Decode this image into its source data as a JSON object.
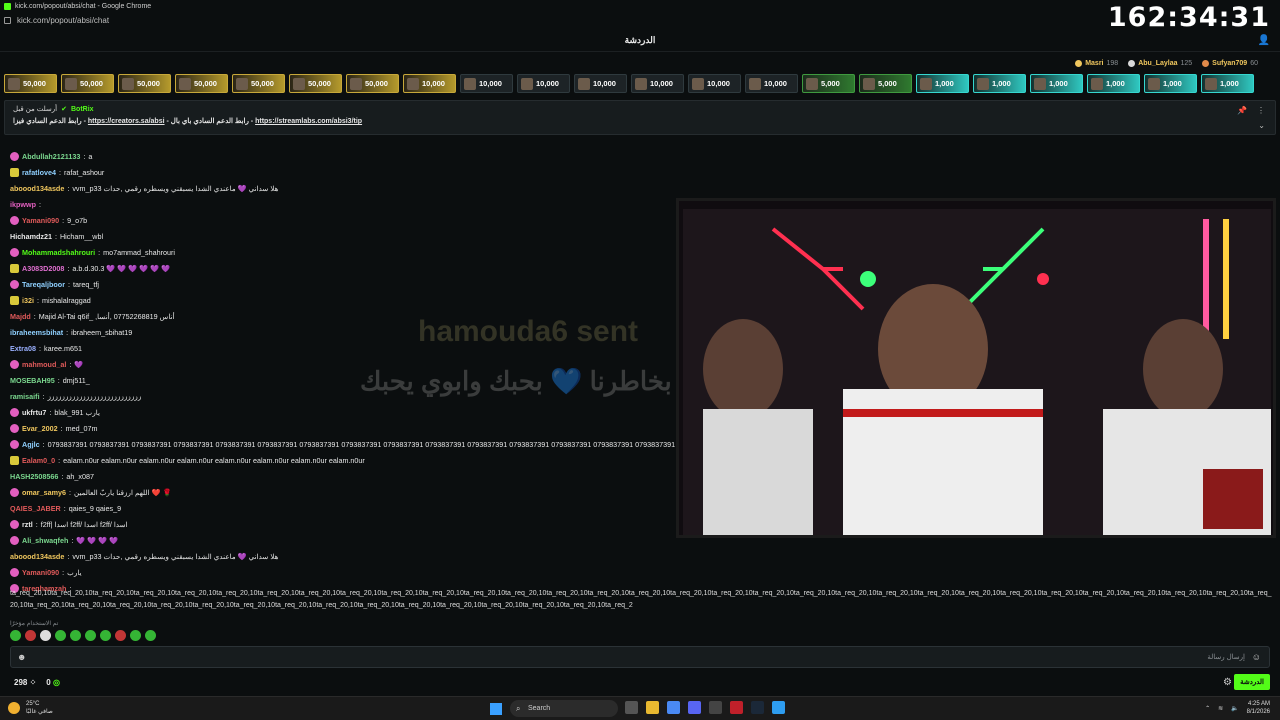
{
  "window": {
    "title": "kick.com/popout/absi/chat - Google Chrome",
    "url": "kick.com/popout/absi/chat"
  },
  "clock": "162:34:31",
  "header": {
    "title": "الدردشة"
  },
  "leaderboard": [
    {
      "name": "Masri",
      "count": "198",
      "color": "#f0c75e"
    },
    {
      "name": "Abu_Laylaa",
      "count": "125",
      "color": "#d9d9d9"
    },
    {
      "name": "Sufyan709",
      "count": "60",
      "color": "#e08a4a"
    }
  ],
  "gifts": [
    {
      "amount": "50,000",
      "style": "gold"
    },
    {
      "amount": "50,000",
      "style": "gold"
    },
    {
      "amount": "50,000",
      "style": "gold"
    },
    {
      "amount": "50,000",
      "style": "gold"
    },
    {
      "amount": "50,000",
      "style": "gold"
    },
    {
      "amount": "50,000",
      "style": "gold"
    },
    {
      "amount": "50,000",
      "style": "gold"
    },
    {
      "amount": "10,000",
      "style": "gold"
    },
    {
      "amount": "10,000",
      "style": "dark"
    },
    {
      "amount": "10,000",
      "style": "dark"
    },
    {
      "amount": "10,000",
      "style": "dark"
    },
    {
      "amount": "10,000",
      "style": "dark"
    },
    {
      "amount": "10,000",
      "style": "dark"
    },
    {
      "amount": "10,000",
      "style": "dark"
    },
    {
      "amount": "5,000",
      "style": "green"
    },
    {
      "amount": "5,000",
      "style": "green"
    },
    {
      "amount": "1,000",
      "style": "teal"
    },
    {
      "amount": "1,000",
      "style": "teal"
    },
    {
      "amount": "1,000",
      "style": "teal"
    },
    {
      "amount": "1,000",
      "style": "teal"
    },
    {
      "amount": "1,000",
      "style": "teal"
    },
    {
      "amount": "1,000",
      "style": "teal"
    }
  ],
  "pinned": {
    "pinned_by": "أرسلت من قبل",
    "bot_name": "BotRix",
    "text_before": "رابط الدعم السادي فيزا - ",
    "link1": "https://creators.sa/absi",
    "text_mid": " - رابط الدعم السادي باي بال - ",
    "link2": "https://streamlabs.com/absi3/tip"
  },
  "messages": [
    {
      "user": "Abdullah2121133",
      "text": "a",
      "color": "#7bd88f",
      "badge": "pink"
    },
    {
      "user": "rafatlove4",
      "text": "rafat_ashour",
      "color": "#8fd0ff",
      "badge": "yellow"
    },
    {
      "user": "aboood134asde",
      "text": "vvm_p33 هلا سداني 💜 ماعندي الشدا يسبقني ويسطره رقمي ,حدات",
      "color": "#f0c75e",
      "badge": ""
    },
    {
      "user": "ikpwwp",
      "text": "",
      "color": "#e25fbf",
      "badge": ""
    },
    {
      "user": "Yamani090",
      "text": "9_o7b",
      "color": "#e05a5a",
      "badge": "pink"
    },
    {
      "user": "Hichamdz21",
      "text": "Hicham__wbl",
      "color": "#e8e8e8",
      "badge": ""
    },
    {
      "user": "Mohammadshahrouri",
      "text": "mo7ammad_shahrouri",
      "color": "#53fc18",
      "badge": "pink"
    },
    {
      "user": "A3083D2008",
      "text": "a.b.d.30.3 💜 💜 💜 💜 💜 💜",
      "color": "#e06fd0",
      "badge": "yellow"
    },
    {
      "user": "Tareqaljboor",
      "text": "tareq_tfj",
      "color": "#8fd0ff",
      "badge": "pink"
    },
    {
      "user": "i32i",
      "text": "mishalalraggad",
      "color": "#f0c75e",
      "badge": "yellow"
    },
    {
      "user": "Majdd",
      "text": "Majid Al-Tai q6if_ ,أناس 07752268819 ,أنسا",
      "color": "#e05a5a",
      "badge": ""
    },
    {
      "user": "ibraheemsbihat",
      "text": "ibraheem_sbihat19",
      "color": "#8fd0ff",
      "badge": ""
    },
    {
      "user": "Extra08",
      "text": "karee.m651",
      "color": "#9ab0ff",
      "badge": ""
    },
    {
      "user": "mahmoud_al",
      "text": "💜",
      "color": "#e05a5a",
      "badge": "pink"
    },
    {
      "user": "MOSEBAH95",
      "text": "dmj511_",
      "color": "#7bd88f",
      "badge": ""
    },
    {
      "user": "ramisaifi",
      "text": "ززززززززززززززززززززززززززز",
      "color": "#7bd88f",
      "badge": ""
    },
    {
      "user": "ukfrtu7",
      "text": "blak_991 يارب",
      "color": "#e8e8e8",
      "badge": "pink"
    },
    {
      "user": "Evar_2002",
      "text": "med_07m",
      "color": "#f0c75e",
      "badge": "pink"
    },
    {
      "user": "Agjlc",
      "text": "0793837391 0793837391 0793837391 0793837391 0793837391 0793837391 0793837391 0793837391 0793837391 0793837391 0793837391 0793837391 0793837391 0793837391 0793837391",
      "color": "#8fd0ff",
      "badge": "pink"
    },
    {
      "user": "Ealam0_0",
      "text": "ealam.n0ur ealam.n0ur ealam.n0ur ealam.n0ur ealam.n0ur ealam.n0ur ealam.n0ur ealam.n0ur",
      "color": "#e05a5a",
      "badge": "yellow"
    },
    {
      "user": "HASH2508566",
      "text": "ah_x087",
      "color": "#7bd88f",
      "badge": ""
    },
    {
      "user": "omar_samy6",
      "text": "اللهم ارزقنا ياربّ العالمين ❤️ 🌹",
      "color": "#f0c75e",
      "badge": "pink"
    },
    {
      "user": "QAIES_JABER",
      "text": "qaies_9 qaies_9",
      "color": "#e05a5a",
      "badge": ""
    },
    {
      "user": "rztl",
      "text": "f2ff| اسدا f2ff/ اسدا f2ff/ اسدا",
      "color": "#e8e8e8",
      "badge": "pink"
    },
    {
      "user": "Ali_shwaqfeh",
      "text": "💜 💜 💜 💜",
      "color": "#7bd88f",
      "badge": "pink"
    },
    {
      "user": "aboood134asde",
      "text": "vvm_p33 هلا سداني 💜 ماعندي الشدا يسبقني ويسطره رقمي ,حدات",
      "color": "#f0c75e",
      "badge": ""
    },
    {
      "user": "Yamani090",
      "text": "يارب",
      "color": "#e05a5a",
      "badge": "pink"
    },
    {
      "user": "tareqhamzah",
      "text": "",
      "color": "#e05a5a",
      "badge": "pink"
    }
  ],
  "long_message": "ta_req_20,10ta_req_20,10ta_req_20,10ta_req_20,10ta_req_20,10ta_req_20,10ta_req_20,10ta_req_20,10ta_req_20,10ta_req_20,10ta_req_20,10ta_req_20,10ta_req_20,10ta_req_20,10ta_req_20,10ta_req_20,10ta_req_20,10ta_req_20,10ta_req_20,10ta_req_20,10ta_req_20,10ta_req_20,10ta_req_20,10ta_req_20,10ta_req_20,10ta_req_20,10ta_req_20,10ta_req_20,10ta_req_20,10ta_req_20,10ta_req_20,10ta_req_20,10ta_req_20,10ta_req_20,10ta_req_20,10ta_req_20,10ta_req_20,10ta_req_20,10ta_req_20,10ta_req_20,10ta_req_20,10ta_req_20,10ta_req_20,10ta_req_20,10ta_req_20,10ta_req_2",
  "overlay": {
    "alert_text": "hamouda6 sent",
    "arabic_line": "الله يجبر بخاطرنا 💙 بحبك وابوي يحبك"
  },
  "emote_label": "تم الاستخدام مؤخرًا",
  "input": {
    "placeholder": "إرسال رسالة"
  },
  "footer": {
    "viewers": "298",
    "points": "0",
    "chat_button": "الدردشة"
  },
  "taskbar": {
    "temp": "25°C",
    "weather": "صافي غالبًا",
    "search": "Search",
    "time": "4:25 AM",
    "date": "8/1/2026"
  }
}
